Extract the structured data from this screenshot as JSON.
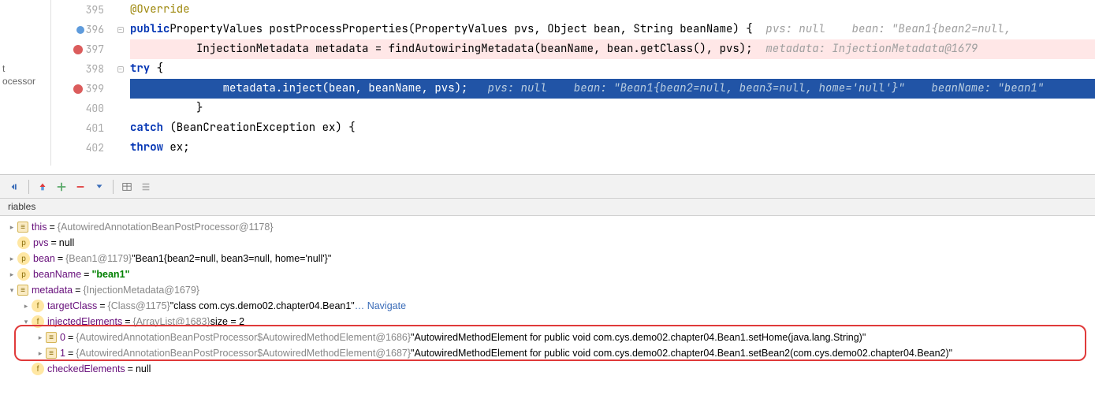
{
  "sidebar": {
    "line1": "t",
    "line2": "ocessor"
  },
  "code": {
    "lines": [
      {
        "num": "395",
        "html": "      <span class='anno'>@Override</span>"
      },
      {
        "num": "396",
        "html": "      <span class='kw'>public</span> <span class='type'>PropertyValues</span> postProcessProperties(PropertyValues pvs, Object bean, String beanName) {  ",
        "hint": "pvs: null    bean: \"Bean1{bean2=null,"
      },
      {
        "num": "397",
        "bp": true,
        "html": "          InjectionMetadata metadata = findAutowiringMetadata(beanName, bean.getClass(), pvs);  ",
        "hint": "metadata: InjectionMetadata@1679"
      },
      {
        "num": "398",
        "html": "          <span class='kw'>try</span> {"
      },
      {
        "num": "399",
        "bp": true,
        "exec": true,
        "html": "              metadata.inject(bean, beanName, pvs);   ",
        "hint": "pvs: null    bean: \"Bean1{bean2=null, bean3=null, home='null'}\"    beanName: \"bean1\""
      },
      {
        "num": "400",
        "html": "          }"
      },
      {
        "num": "401",
        "html": "          <span class='kw'>catch</span> (BeanCreationException ex) {"
      },
      {
        "num": "402",
        "html": "              <span class='kw'>throw</span> ex;"
      }
    ]
  },
  "vars_header": "riables",
  "vars": {
    "this": {
      "name": "this",
      "ref": "{AutowiredAnnotationBeanPostProcessor@1178}"
    },
    "pvs": {
      "name": "pvs",
      "val": "null"
    },
    "bean": {
      "name": "bean",
      "ref": "{Bean1@1179}",
      "val": "\"Bean1{bean2=null, bean3=null, home='null'}\""
    },
    "beanName": {
      "name": "beanName",
      "val": "\"bean1\""
    },
    "metadata": {
      "name": "metadata",
      "ref": "{InjectionMetadata@1679}"
    },
    "targetClass": {
      "name": "targetClass",
      "ref": "{Class@1175}",
      "val": "\"class com.cys.demo02.chapter04.Bean1\"",
      "link": "… Navigate"
    },
    "injectedElements": {
      "name": "injectedElements",
      "ref": "{ArrayList@1683}",
      "size": " size = 2"
    },
    "el0": {
      "idx": "0",
      "ref": "{AutowiredAnnotationBeanPostProcessor$AutowiredMethodElement@1686}",
      "val": "\"AutowiredMethodElement for public void com.cys.demo02.chapter04.Bean1.setHome(java.lang.String)\""
    },
    "el1": {
      "idx": "1",
      "ref": "{AutowiredAnnotationBeanPostProcessor$AutowiredMethodElement@1687}",
      "val": "\"AutowiredMethodElement for public void com.cys.demo02.chapter04.Bean1.setBean2(com.cys.demo02.chapter04.Bean2)\""
    },
    "checkedElements": {
      "name": "checkedElements",
      "val": "null"
    }
  }
}
